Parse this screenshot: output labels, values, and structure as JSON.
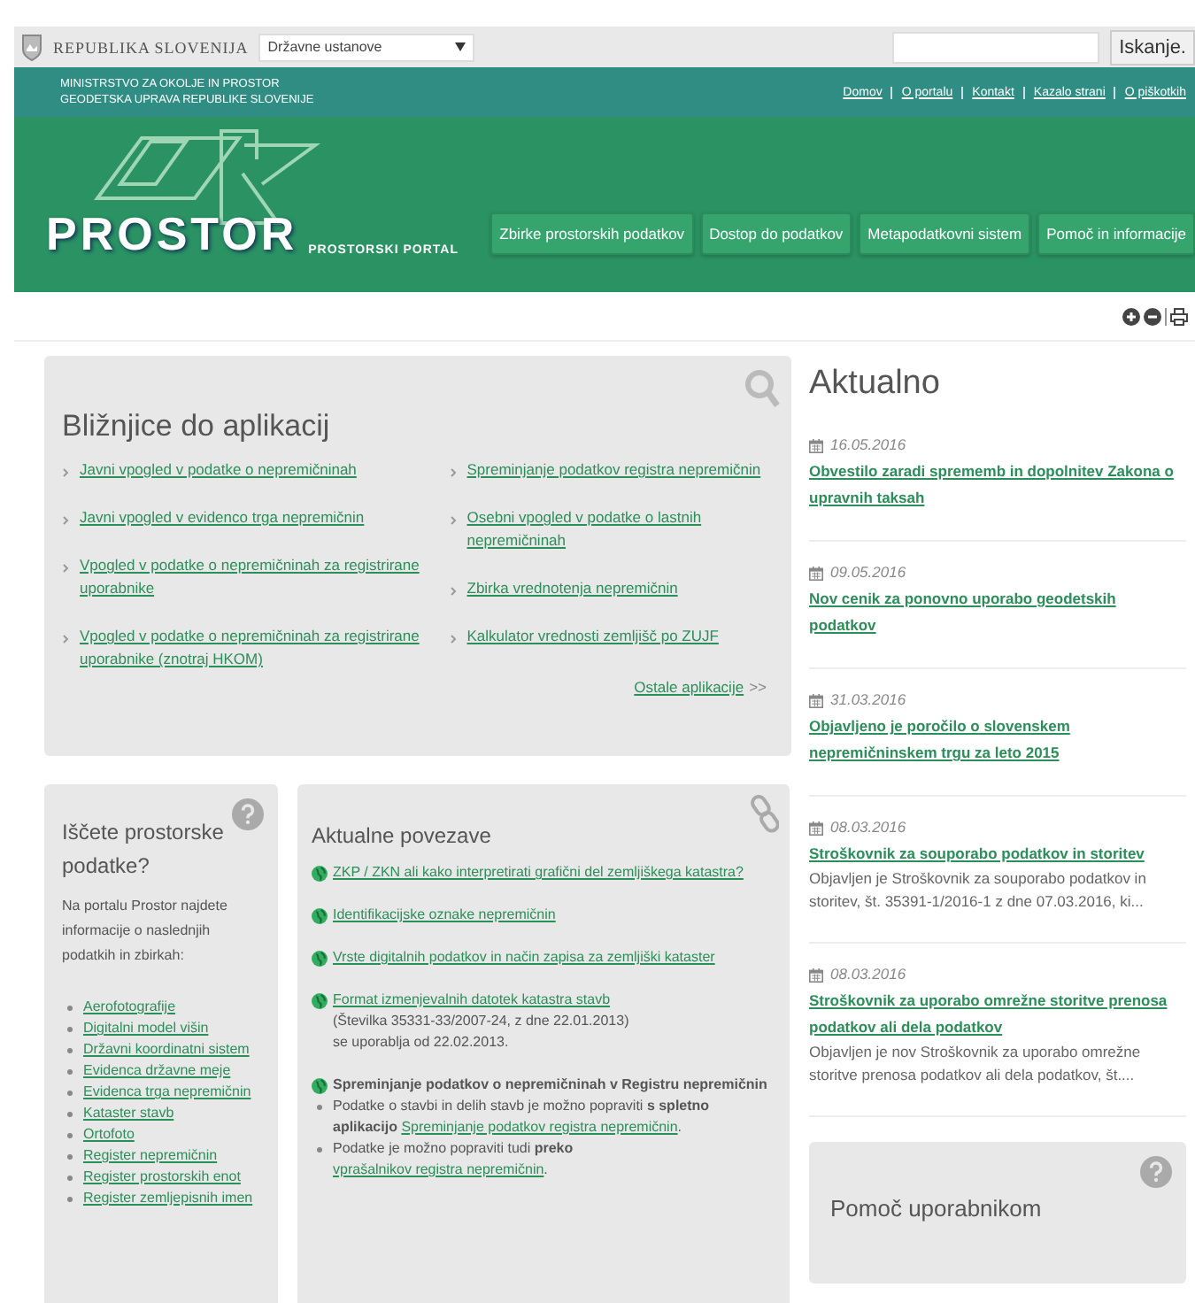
{
  "top_bar": {
    "country": "REPUBLIKA SLOVENIJA",
    "institution_select": {
      "value": "Državne ustanove"
    },
    "search": {
      "button": "Iskanje."
    }
  },
  "ministry_bar": {
    "lines": [
      "MINISTRSTVO ZA OKOLJE IN PROSTOR",
      "GEODETSKA UPRAVA REPUBLIKE SLOVENIJE"
    ],
    "links": [
      "Domov",
      "O portalu",
      "Kontakt",
      "Kazalo strani",
      "O piškotkih"
    ]
  },
  "header": {
    "logo": "PROSTOR",
    "subtitle": "PROSTORSKI PORTAL",
    "nav": [
      "Zbirke prostorskih podatkov",
      "Dostop do podatkov",
      "Metapodatkovni sistem",
      "Pomoč in informacije"
    ]
  },
  "shortcuts": {
    "title": "Bližnjice do aplikacij",
    "columns": [
      [
        "Javni vpogled v podatke o nepremičninah",
        "Javni vpogled v evidenco trga nepremičnin",
        "Vpogled v podatke o nepremičninah za registrirane uporabnike",
        "Vpogled v podatke o nepremičninah za registrirane uporabnike (znotraj HKOM)"
      ],
      [
        "Spreminjanje podatkov registra nepremičnin",
        "Osebni vpogled v podatke o lastnih nepremičninah",
        "Zbirka vrednotenja nepremičnin",
        "Kalkulator vrednosti zemljišč po ZUJF"
      ]
    ],
    "more_link": "Ostale aplikacije",
    "more_arrows": ">>"
  },
  "search_data": {
    "title": "Iščete prostorske podatke?",
    "intro": "Na portalu Prostor najdete informacije o naslednjih podatkih in zbirkah:",
    "items": [
      "Aerofotografije",
      "Digitalni model višin",
      "Državni koordinatni sistem",
      "Evidenca državne meje",
      "Evidenca trga nepremičnin",
      "Kataster stavb",
      "Ortofoto",
      "Register nepremičnin",
      "Register prostorskih enot",
      "Register zemljepisnih imen"
    ]
  },
  "links_card": {
    "title": "Aktualne povezave",
    "items": [
      {
        "kind": "link",
        "text": "ZKP / ZKN ali kako interpretirati grafični del zemljiškega katastra?"
      },
      {
        "kind": "link",
        "text": "Identifikacijske oznake nepremičnin"
      },
      {
        "kind": "link",
        "text": "Vrste digitalnih podatkov in način zapisa za zemljiški kataster"
      },
      {
        "kind": "link",
        "text": "Format izmenjevalnih datotek katastra stavb",
        "notes": [
          "(Številka 35331-33/2007-24, z dne 22.01.2013)",
          "se uporablja od 22.02.2013."
        ]
      },
      {
        "kind": "section",
        "text": "Spreminjanje podatkov o nepremičninah v Registru nepremičnin",
        "bullets": [
          {
            "text": "Podatke o stavbi in delih stavb je možno popraviti **s spletno aplikacijo**",
            "link": "Spreminjanje podatkov registra nepremičnin",
            "suffix": "."
          },
          {
            "text": "Podatke je možno popraviti tudi **preko**",
            "link": "vprašalnikov registra nepremičnin",
            "suffix": "."
          }
        ]
      }
    ]
  },
  "news": {
    "title": "Aktualno",
    "items": [
      {
        "date": "16.05.2016",
        "title": "Obvestilo zaradi sprememb in dopolnitev Zakona o upravnih taksah"
      },
      {
        "date": "09.05.2016",
        "title": "Nov cenik za ponovno uporabo geodetskih podatkov"
      },
      {
        "date": "31.03.2016",
        "title": "Objavljeno je poročilo o slovenskem nepremičninskem trgu za leto 2015"
      },
      {
        "date": "08.03.2016",
        "title": "Stroškovnik za souporabo podatkov in storitev",
        "summary": "Objavljen je Stroškovnik za souporabo podatkov in storitev, št. 35391-1/2016-1 z dne 07.03.2016, ki..."
      },
      {
        "date": "08.03.2016",
        "title": "Stroškovnik za uporabo omrežne storitve prenosa podatkov ali dela podatkov",
        "summary": "Objavljen je nov Stroškovnik za uporabo omrežne storitve prenosa podatkov ali dela podatkov, št...."
      }
    ]
  },
  "help": {
    "title": "Pomoč uporabnikom"
  }
}
